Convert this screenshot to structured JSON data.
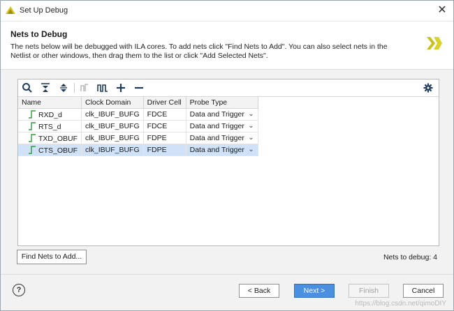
{
  "window": {
    "title": "Set Up Debug"
  },
  "header": {
    "heading": "Nets to Debug",
    "description": "The nets below will be debugged with ILA cores. To add nets click \"Find Nets to Add\". You can also select nets in the Netlist or other windows, then drag them to the list or click \"Add Selected Nets\"."
  },
  "table": {
    "columns": [
      "Name",
      "Clock Domain",
      "Driver Cell",
      "Probe Type"
    ],
    "rows": [
      {
        "name": "RXD_d",
        "clock": "clk_IBUF_BUFG",
        "driver": "FDCE",
        "probe": "Data and Trigger",
        "selected": false
      },
      {
        "name": "RTS_d",
        "clock": "clk_IBUF_BUFG",
        "driver": "FDCE",
        "probe": "Data and Trigger",
        "selected": false
      },
      {
        "name": "TXD_OBUF",
        "clock": "clk_IBUF_BUFG",
        "driver": "FDPE",
        "probe": "Data and Trigger",
        "selected": false
      },
      {
        "name": "CTS_OBUF",
        "clock": "clk_IBUF_BUFG",
        "driver": "FDPE",
        "probe": "Data and Trigger",
        "selected": true
      }
    ]
  },
  "actions": {
    "find_label": "Find Nets to Add...",
    "count_label": "Nets to debug: 4"
  },
  "footer": {
    "help": "?",
    "back": "< Back",
    "next": "Next >",
    "finish": "Finish",
    "cancel": "Cancel"
  },
  "watermark": "https://blog.csdn.net/qimoDIY",
  "colors": {
    "accent": "#4b8fe0",
    "selection": "#cfe2f7",
    "wave_icon": "#2e9a3a",
    "logo": "#c8c01e"
  }
}
